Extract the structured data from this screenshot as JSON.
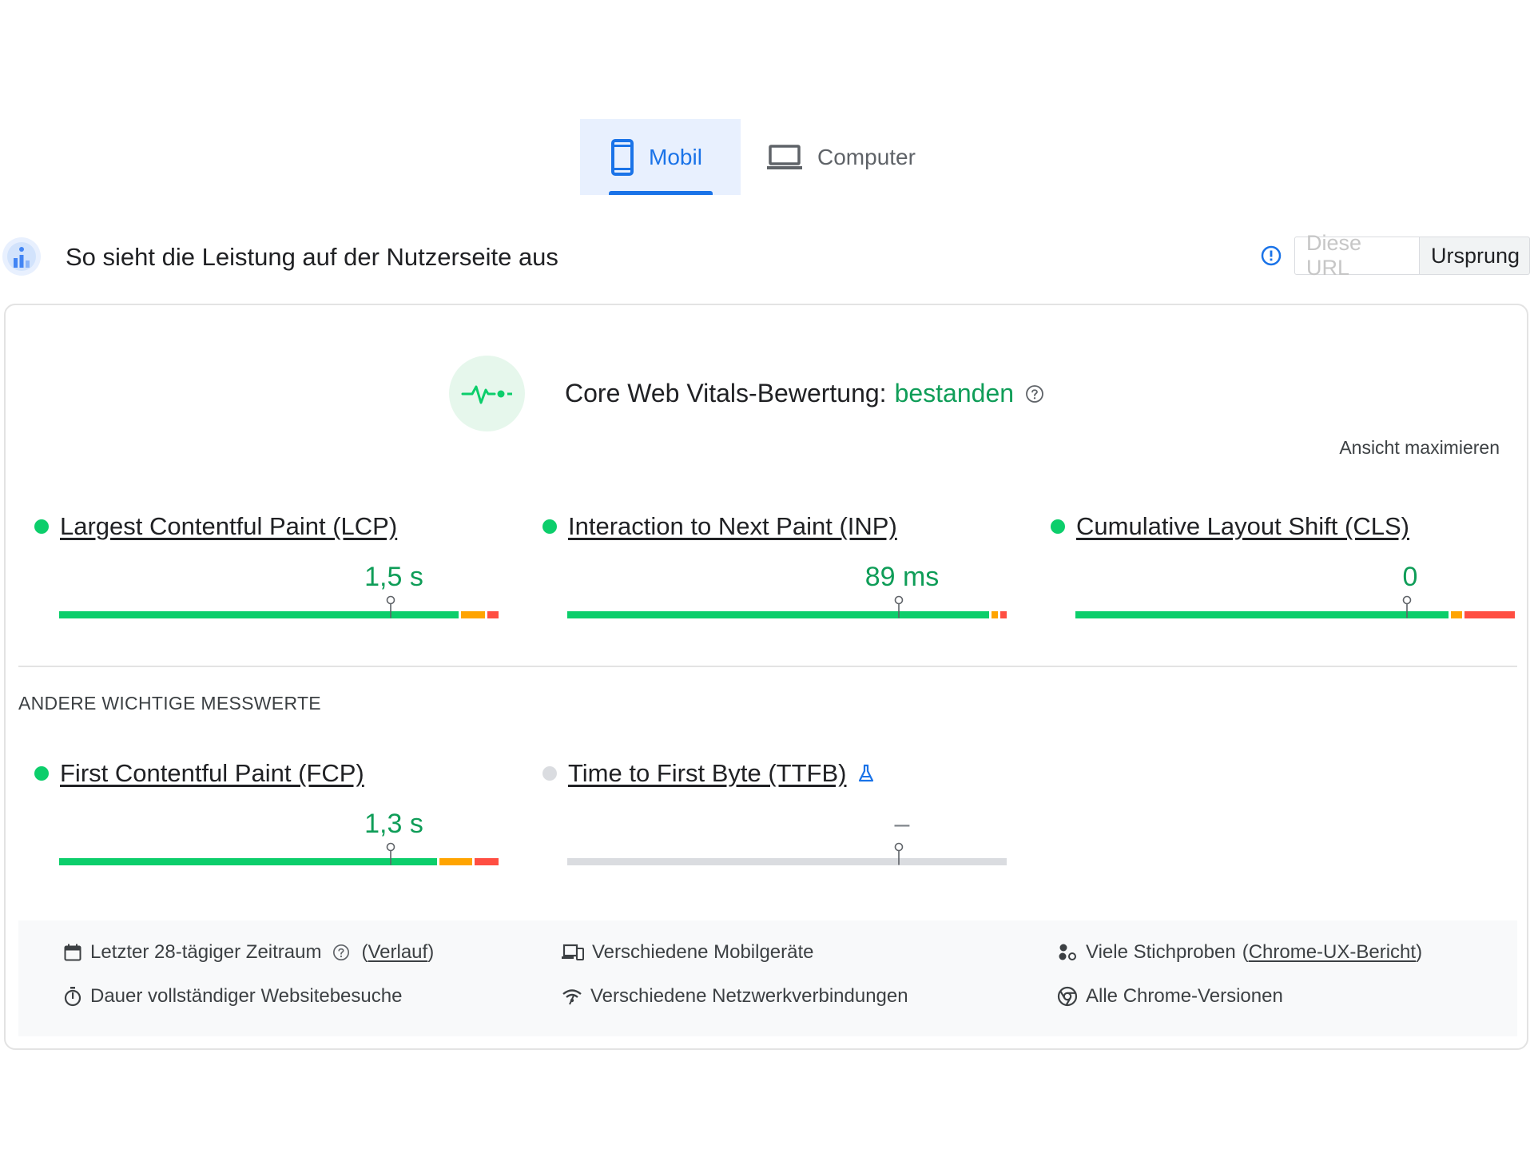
{
  "tabs": [
    {
      "label": "Mobil",
      "icon": "smartphone-icon",
      "active": true
    },
    {
      "label": "Computer",
      "icon": "laptop-icon",
      "active": false
    }
  ],
  "header": {
    "title": "So sieht die Leistung auf der Nutzerseite aus",
    "icon": "crux-chart-icon",
    "toggle": {
      "this_url": "Diese URL",
      "origin": "Ursprung",
      "selected": "Ursprung"
    }
  },
  "assessment": {
    "prefix": "Core Web Vitals-Bewertung:",
    "status": "bestanden",
    "icon": "pulse-icon",
    "maximize": "Ansicht maximieren"
  },
  "colors": {
    "good": "#0cce6b",
    "needs_improvement": "#ffa400",
    "poor": "#ff4e42",
    "accent": "#1a73e8",
    "status_text": "#0f9d58",
    "na": "#dadce0"
  },
  "core_metrics": [
    {
      "name": "Largest Contentful Paint (LCP)",
      "value": "1,5 s",
      "distribution": {
        "good": 0.91,
        "needs_improvement": 0.06,
        "poor": 0.03
      },
      "marker": 0.75
    },
    {
      "name": "Interaction to Next Paint (INP)",
      "value": "89 ms",
      "distribution": {
        "good": 0.96,
        "needs_improvement": 0.02,
        "poor": 0.02
      },
      "marker": 0.75
    },
    {
      "name": "Cumulative Layout Shift (CLS)",
      "value": "0",
      "distribution": {
        "good": 0.85,
        "needs_improvement": 0.03,
        "poor": 0.12
      },
      "marker": 0.75
    }
  ],
  "other_label": "ANDERE WICHTIGE MESSWERTE",
  "other_metrics": [
    {
      "name": "First Contentful Paint (FCP)",
      "value": "1,3 s",
      "distribution": {
        "good": 0.86,
        "needs_improvement": 0.08,
        "poor": 0.06
      },
      "marker": 0.75,
      "status": "good"
    },
    {
      "name": "Time to First Byte (TTFB)",
      "value": "–",
      "distribution": {
        "na": 1
      },
      "marker": 0.75,
      "status": "na",
      "experimental": true
    }
  ],
  "footer": {
    "period": "Letzter 28-tägiger Zeitraum",
    "period_link": "Verlauf",
    "duration": "Dauer vollständiger Websitebesuche",
    "devices": "Verschiedene Mobilgeräte",
    "network": "Verschiedene Netzwerkverbindungen",
    "samples": "Viele Stichproben",
    "samples_link": "Chrome-UX-Bericht",
    "versions": "Alle Chrome-Versionen"
  }
}
